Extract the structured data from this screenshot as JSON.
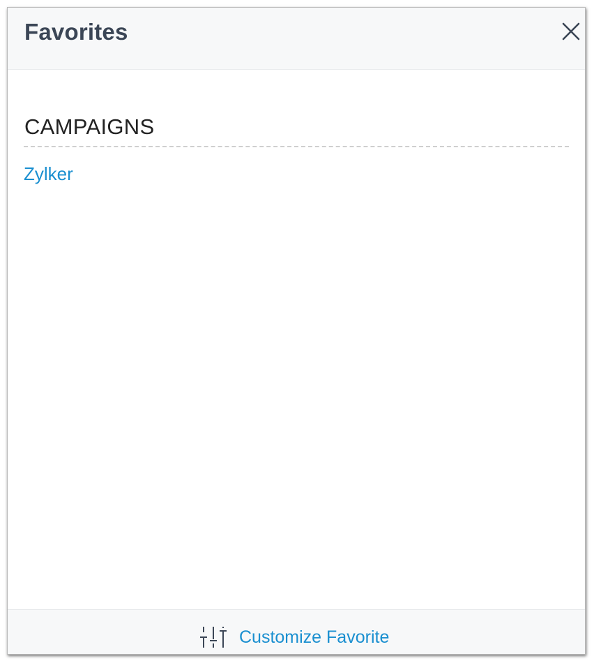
{
  "panel": {
    "title": "Favorites",
    "close_icon": "close-icon"
  },
  "section": {
    "heading": "CAMPAIGNS",
    "items": [
      {
        "label": "Zylker"
      }
    ]
  },
  "footer": {
    "icon": "sliders-icon",
    "label": "Customize Favorite"
  },
  "colors": {
    "title": "#3b4656",
    "link": "#1a8fd0",
    "header_bg": "#f7f8f9",
    "heading": "#222222"
  }
}
